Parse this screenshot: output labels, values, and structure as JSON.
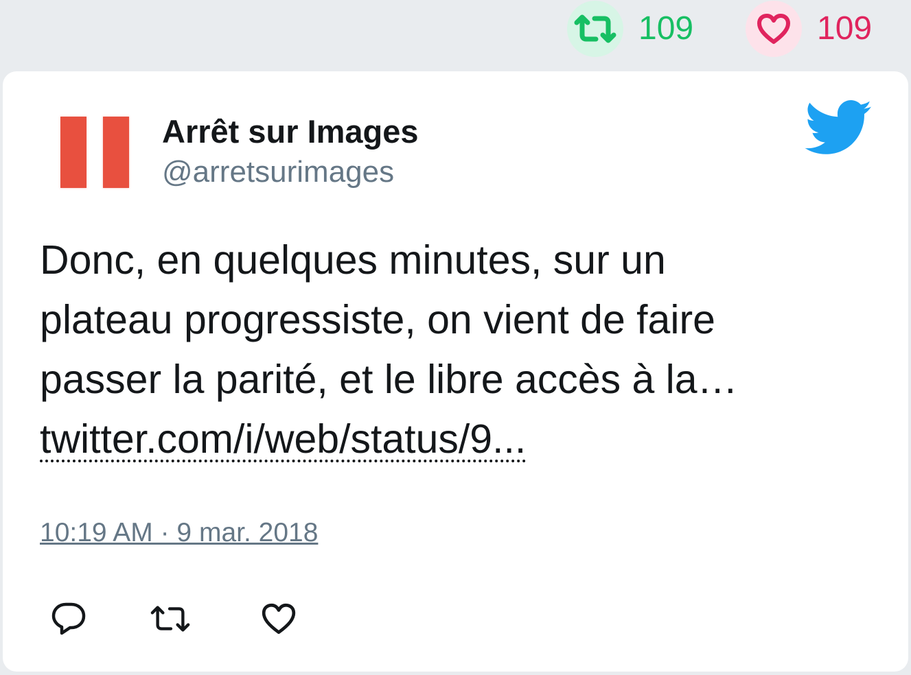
{
  "stats": {
    "retweets": "109",
    "likes": "109",
    "retweet_icon": "retweet-icon",
    "like_icon": "heart-icon",
    "retweet_color": "#17bf63",
    "like_color": "#e0245e"
  },
  "tweet": {
    "author_name": "Arrêt sur Images",
    "author_handle": "@arretsurimages",
    "text_lines": [
      "Donc, en quelques minutes, sur un",
      "plateau progressiste, on vient de faire",
      "passer la parité, et le libre accès à la…"
    ],
    "link": "twitter.com/i/web/status/9...",
    "timestamp": "10:19 AM · 9 mar. 2018",
    "avatar_icon": "pause-logo",
    "brand_icon": "twitter-bird-icon",
    "brand_color": "#1da1f2",
    "actions": [
      "reply-icon",
      "retweet-icon",
      "heart-icon"
    ]
  }
}
